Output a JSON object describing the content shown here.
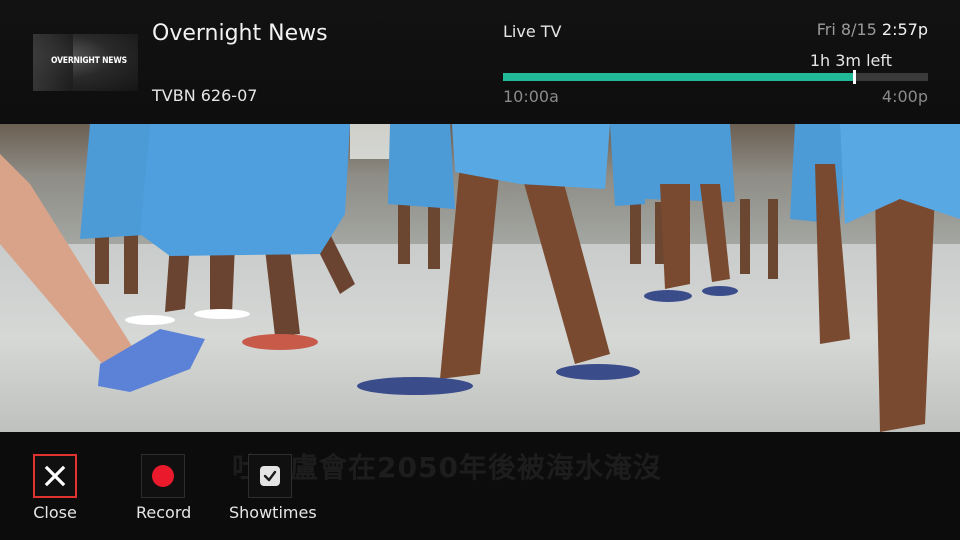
{
  "program": {
    "thumbnail_text": "OVERNIGHT NEWS",
    "title": "Overnight News",
    "channel": "TVBN 626-07"
  },
  "status": {
    "mode_label": "Live TV",
    "date": "Fri 8/15",
    "time": "2:57p",
    "time_left": "1h 3m left",
    "start_time": "10:00a",
    "end_time": "4:00p",
    "progress": 0.825,
    "progress_color": "#22b998"
  },
  "subtitle": "吐瓦盧會在2050年後被海水淹沒",
  "actions": [
    {
      "label": "Close",
      "icon": "close-icon",
      "selected": true
    },
    {
      "label": "Record",
      "icon": "record-icon",
      "selected": false
    },
    {
      "label": "Showtimes",
      "icon": "clock-icon",
      "selected": false
    }
  ],
  "colors": {
    "accent": "#22b998",
    "selection": "#e0322e",
    "record": "#ea1a2c"
  }
}
